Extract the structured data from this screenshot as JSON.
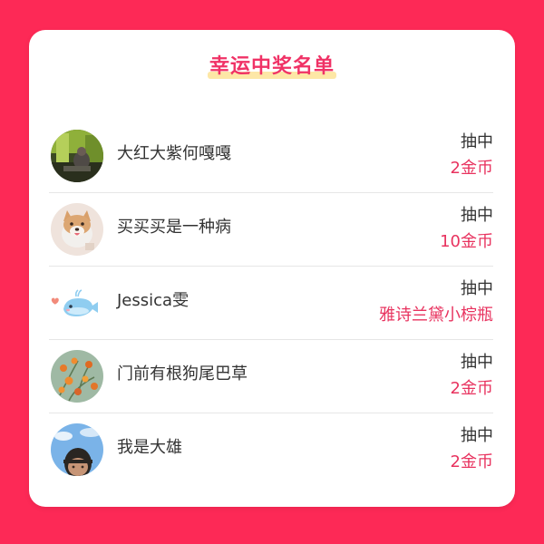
{
  "title": "幸运中奖名单",
  "colors": {
    "background": "#fd2956",
    "title": "#f03266",
    "title_highlight": "#fde7a6",
    "prize_value": "#e8335f"
  },
  "winners": [
    {
      "name": "大红大紫何嘎嘎",
      "label": "抽中",
      "prize": "2金币",
      "avatar": "avatar-photo-green-room"
    },
    {
      "name": "买买买是一种病",
      "label": "抽中",
      "prize": "10金币",
      "avatar": "avatar-shiba-dog"
    },
    {
      "name": "Jessica雯",
      "label": "抽中",
      "prize": "雅诗兰黛小棕瓶",
      "avatar": "avatar-blue-whale"
    },
    {
      "name": "门前有根狗尾巴草",
      "label": "抽中",
      "prize": "2金币",
      "avatar": "avatar-orange-flowers"
    },
    {
      "name": "我是大雄",
      "label": "抽中",
      "prize": "2金币",
      "avatar": "avatar-person-sky"
    }
  ]
}
